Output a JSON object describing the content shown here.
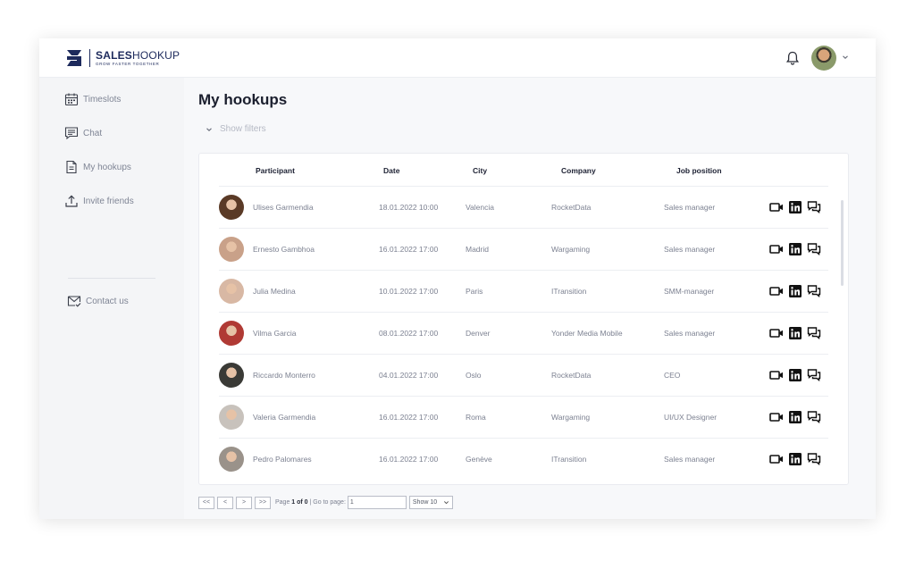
{
  "brand": {
    "name_bold": "SALES",
    "name_regular": "HOOKUP",
    "tagline": "GROW FASTER TOGETHER",
    "color": "#1d2a5c"
  },
  "header": {
    "notification_icon": "bell-icon",
    "avatar_icon": "user-avatar",
    "menu_icon": "chevron-down-icon"
  },
  "sidebar": {
    "items": [
      {
        "label": "Timeslots",
        "icon": "calendar-icon"
      },
      {
        "label": "Chat",
        "icon": "chat-icon"
      },
      {
        "label": "My hookups",
        "icon": "document-icon"
      },
      {
        "label": "Invite friends",
        "icon": "upload-icon"
      }
    ],
    "footer_item": {
      "label": "Contact us",
      "icon": "mail-check-icon"
    }
  },
  "main": {
    "title": "My hookups",
    "filters_label": "Show filters"
  },
  "table": {
    "columns": [
      "Participant",
      "Date",
      "City",
      "Company",
      "Job position"
    ],
    "rows": [
      {
        "name": "Ulises Garmendia",
        "date": "18.01.2022 10:00",
        "city": "Valencia",
        "company": "RocketData",
        "position": "Sales manager",
        "avatar": "#5a3a26"
      },
      {
        "name": "Ernesto Gambhoa",
        "date": "16.01.2022 17:00",
        "city": "Madrid",
        "company": "Wargaming",
        "position": "Sales manager",
        "avatar": "#c9a189"
      },
      {
        "name": "Julia Medina",
        "date": "10.01.2022 17:00",
        "city": "Paris",
        "company": "ITransition",
        "position": "SMM-manager",
        "avatar": "#d8b8a4"
      },
      {
        "name": "Vilma Garcia",
        "date": "08.01.2022 17:00",
        "city": "Denver",
        "company": "Yonder Media Mobile",
        "position": "Sales manager",
        "avatar": "#b03a34"
      },
      {
        "name": "Riccardo Monterro",
        "date": "04.01.2022 17:00",
        "city": "Oslo",
        "company": "RocketData",
        "position": "CEO",
        "avatar": "#3a3a36"
      },
      {
        "name": "Valeria Garmendia",
        "date": "16.01.2022 17:00",
        "city": "Roma",
        "company": "Wargaming",
        "position": "UI/UX Designer",
        "avatar": "#c8c2bc"
      },
      {
        "name": "Pedro Palomares",
        "date": "16.01.2022 17:00",
        "city": "Genève",
        "company": "ITransition",
        "position": "Sales manager",
        "avatar": "#9a928a"
      }
    ],
    "action_icons": [
      "video-icon",
      "linkedin-icon",
      "message-icon"
    ]
  },
  "pagination": {
    "first": "<<",
    "prev": "<",
    "next": ">",
    "last": ">>",
    "page_prefix": "Page ",
    "page_current": "1 of 0",
    "goto_label": " | Go to page:",
    "goto_value": "1",
    "show_label": "Show 10"
  }
}
